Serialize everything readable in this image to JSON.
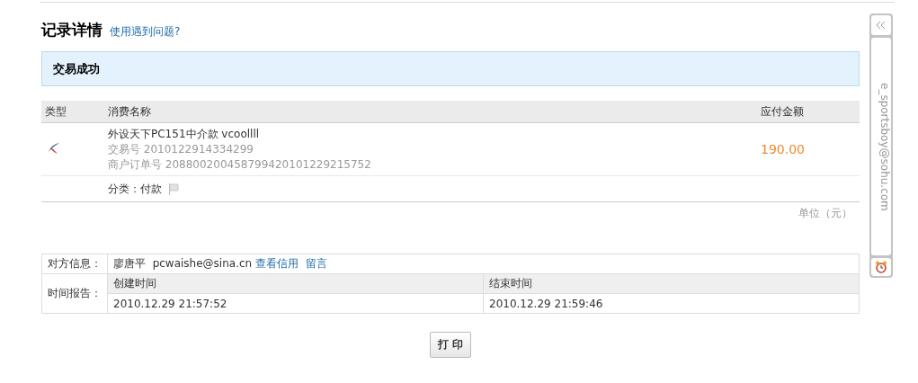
{
  "title": "记录详情",
  "help_link": "使用遇到问题?",
  "status": "交易成功",
  "items_table": {
    "columns": [
      "类型",
      "消费名称",
      "应付金额"
    ],
    "rows": [
      {
        "name": "外设天下PC151中介款  vcoollll",
        "trade_no": "交易号  2010122914334299",
        "order_no": "商户订单号  208800200458799420101229215752",
        "amount": "190.00",
        "category": "分类：付款"
      }
    ]
  },
  "unit": "单位（元）",
  "counterparty": {
    "label": "对方信息：",
    "name": "廖唐平",
    "email": "pcwaishe@sina.cn",
    "links": [
      "查看信用",
      "留言"
    ]
  },
  "time_report": {
    "label": "时间报告：",
    "columns": [
      "创建时间",
      "结束时间"
    ],
    "values": [
      "2010.12.29 21:57:52",
      "2010.12.29 21:59:46"
    ]
  },
  "print_button": "打 印",
  "sidebar": {
    "email": "e_sportsboy@sohu.com"
  }
}
